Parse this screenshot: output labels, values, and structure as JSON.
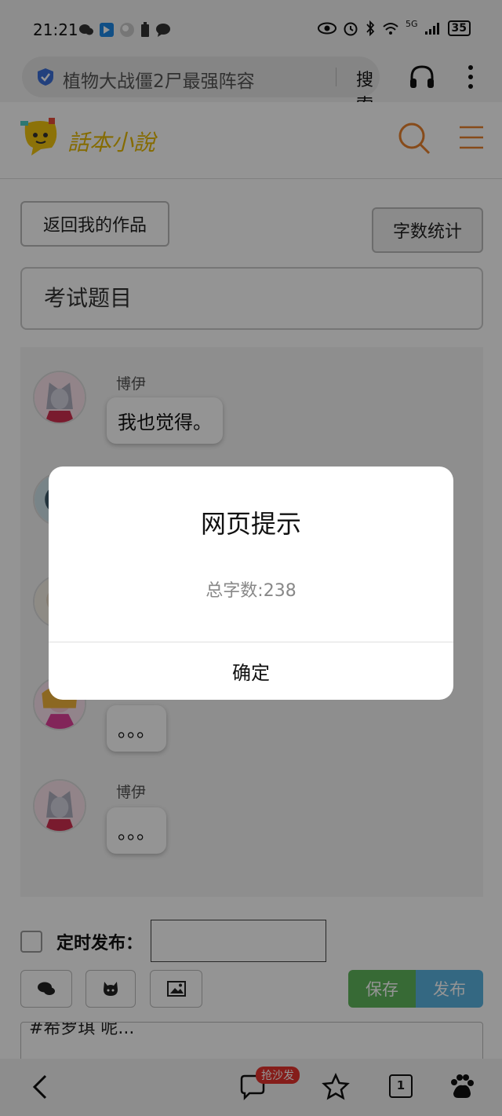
{
  "status_bar": {
    "time": "21:21",
    "battery": "35",
    "network": "5G"
  },
  "browser": {
    "search_text": "植物大战僵2尸最强阵容",
    "search_button": "搜索"
  },
  "site": {
    "logo_text": "話本小說"
  },
  "page": {
    "back_button": "返回我的作品",
    "word_count_button": "字数统计",
    "work_title": "考试题目",
    "messages": [
      {
        "name": "博伊",
        "text": "我也觉得。"
      },
      {
        "name": "",
        "text": ""
      },
      {
        "name": "",
        "text": ""
      },
      {
        "name": "",
        "text": "。。。"
      },
      {
        "name": "博伊",
        "text": "。。。"
      }
    ],
    "timer_label": "定时发布：",
    "save_button": "保存",
    "publish_button": "发布",
    "editor_preview": "#希罗琪 呢..."
  },
  "bottom_nav": {
    "sofa_badge": "抢沙发",
    "tab_count": "1"
  },
  "dialog": {
    "title": "网页提示",
    "message": "总字数:238",
    "ok_button": "确定"
  },
  "colors": {
    "accent_orange": "#e8822e",
    "save_green": "#5fb75c",
    "publish_blue": "#5bb3e0",
    "badge_red": "#e5322d",
    "logo_yellow": "#e6b800"
  }
}
